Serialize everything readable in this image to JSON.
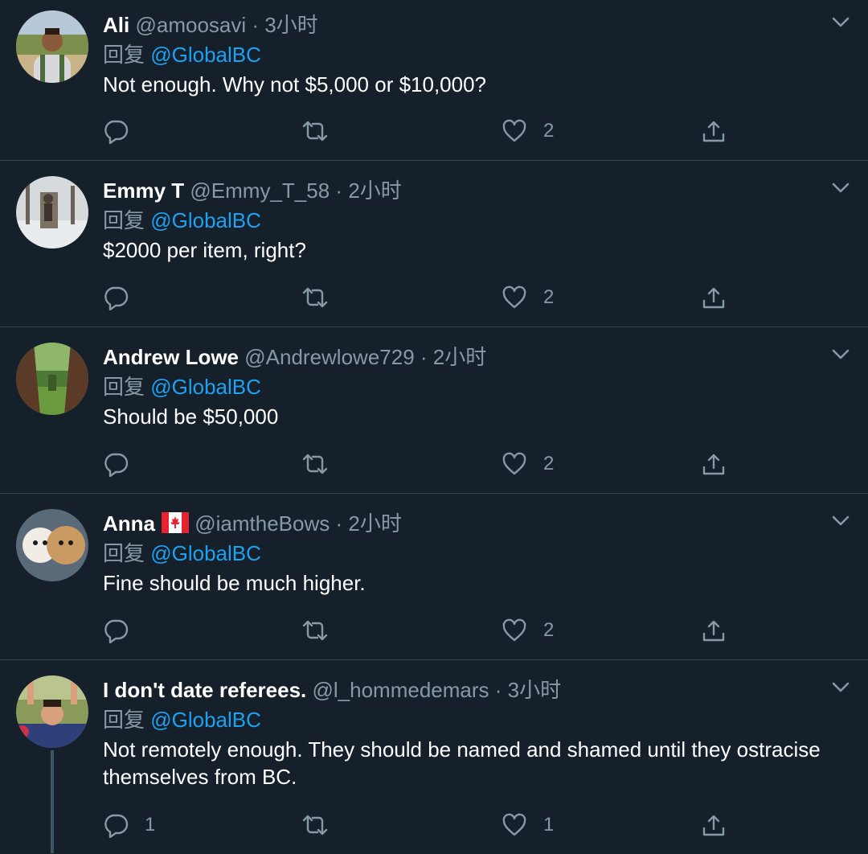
{
  "tweets": [
    {
      "name": "Ali",
      "handle": "@amoosavi",
      "dot": "·",
      "time": "3小时",
      "reply_prefix": "回复 ",
      "reply_to": "@GlobalBC",
      "text": "Not enough. Why not $5,000 or $10,000?",
      "reply_count": "",
      "retweet_count": "",
      "like_count": "2"
    },
    {
      "name": "Emmy T",
      "handle": "@Emmy_T_58",
      "dot": "·",
      "time": "2小时",
      "reply_prefix": "回复 ",
      "reply_to": "@GlobalBC",
      "text": "$2000 per item, right?",
      "reply_count": "",
      "retweet_count": "",
      "like_count": "2"
    },
    {
      "name": "Andrew Lowe",
      "handle": "@Andrewlowe729",
      "dot": "·",
      "time": "2小时",
      "reply_prefix": "回复 ",
      "reply_to": "@GlobalBC",
      "text": "Should be $50,000",
      "reply_count": "",
      "retweet_count": "",
      "like_count": "2"
    },
    {
      "name": "Anna",
      "handle": "@iamtheBows",
      "dot": "·",
      "time": "2小时",
      "reply_prefix": "回复 ",
      "reply_to": "@GlobalBC",
      "text": "Fine should be much higher.",
      "reply_count": "",
      "retweet_count": "",
      "like_count": "2"
    },
    {
      "name": "I don't date referees.",
      "handle": "@l_hommedemars",
      "dot": "·",
      "time": "3小时",
      "reply_prefix": "回复 ",
      "reply_to": "@GlobalBC",
      "text": "Not remotely enough. They should be named and shamed until they ostracise themselves from BC.",
      "reply_count": "1",
      "retweet_count": "",
      "like_count": "1"
    }
  ],
  "colors": {
    "background": "#15202b",
    "divider": "#38444d",
    "secondary_text": "#8899a6",
    "link": "#1da1f2"
  },
  "icons": [
    "chevron-down-icon",
    "reply-icon",
    "retweet-icon",
    "like-icon",
    "share-icon",
    "canada-flag-icon"
  ]
}
